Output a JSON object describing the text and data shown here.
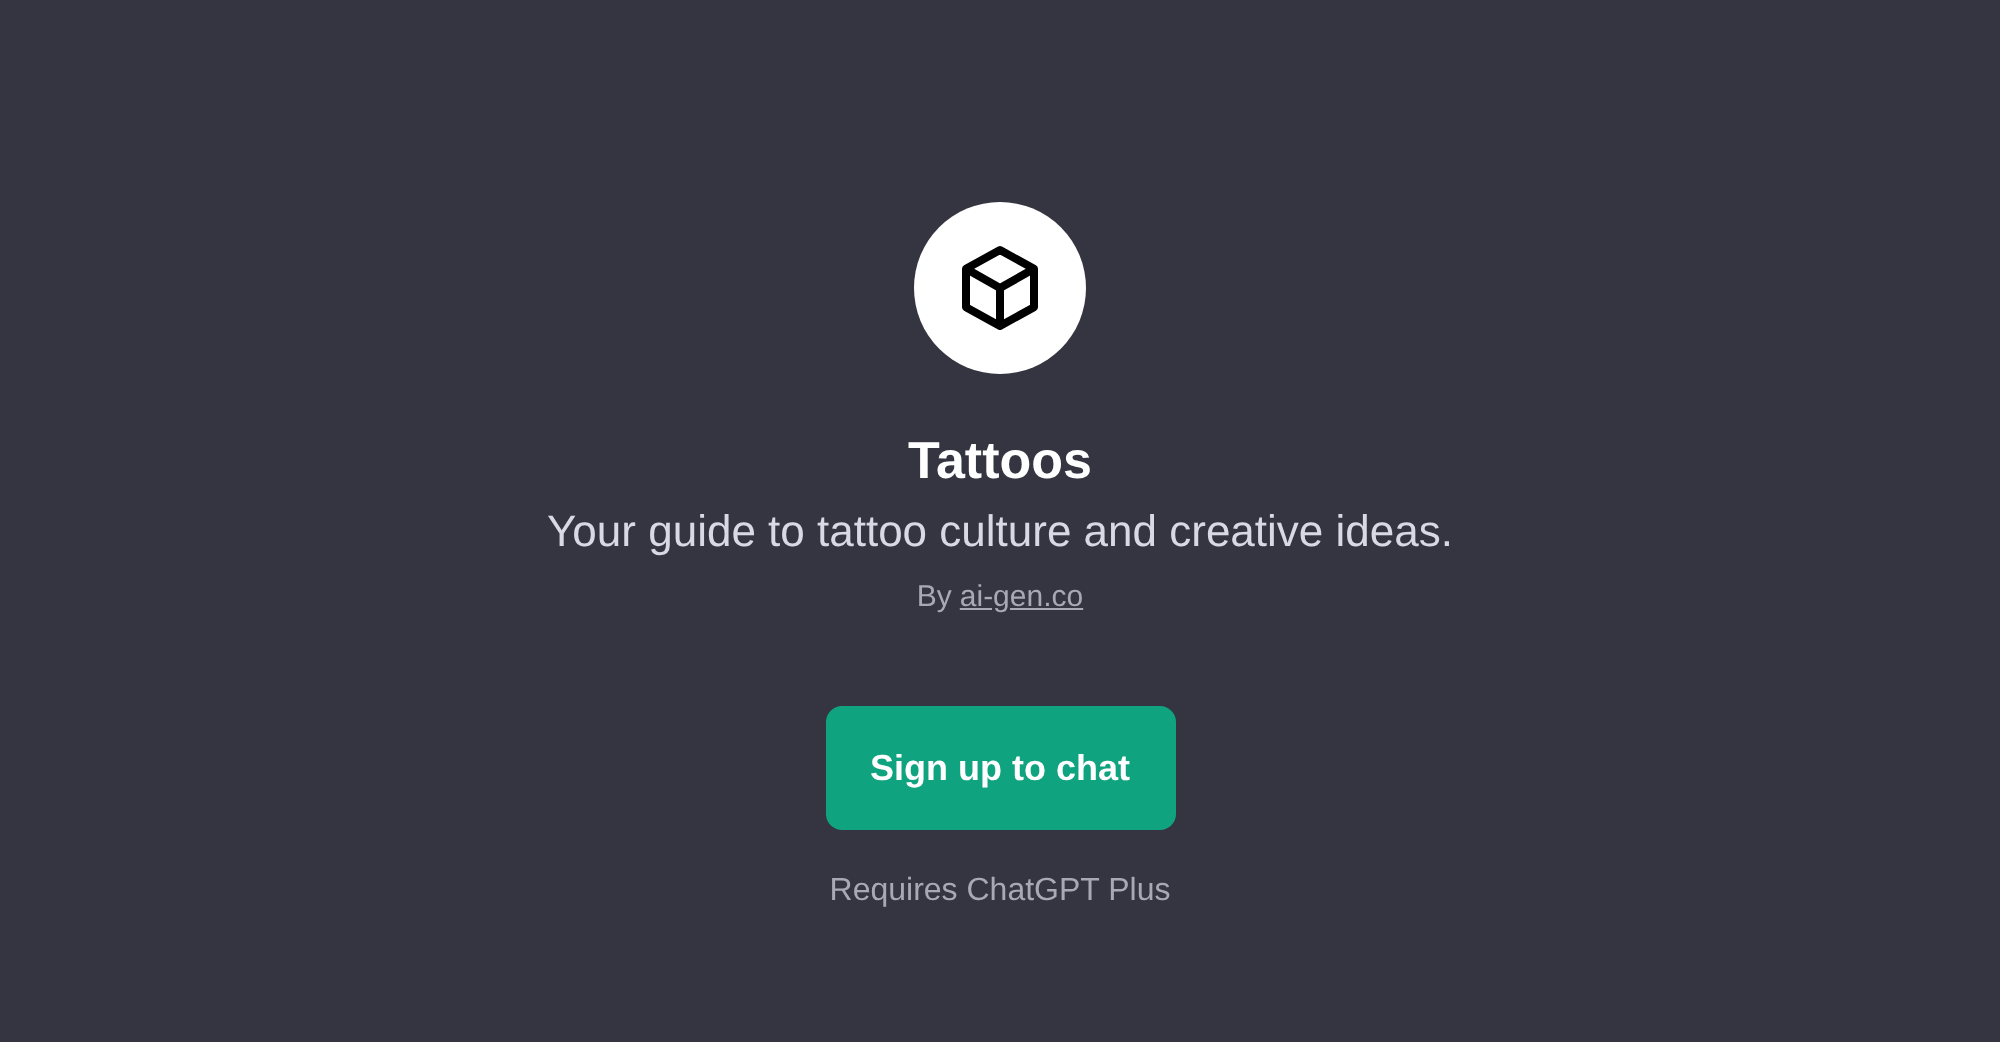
{
  "gpt": {
    "title": "Tattoos",
    "description": "Your guide to tattoo culture and creative ideas.",
    "author_prefix": "By",
    "author_link": "ai-gen.co"
  },
  "signup_button": "Sign up to chat",
  "requirement": "Requires ChatGPT Plus"
}
